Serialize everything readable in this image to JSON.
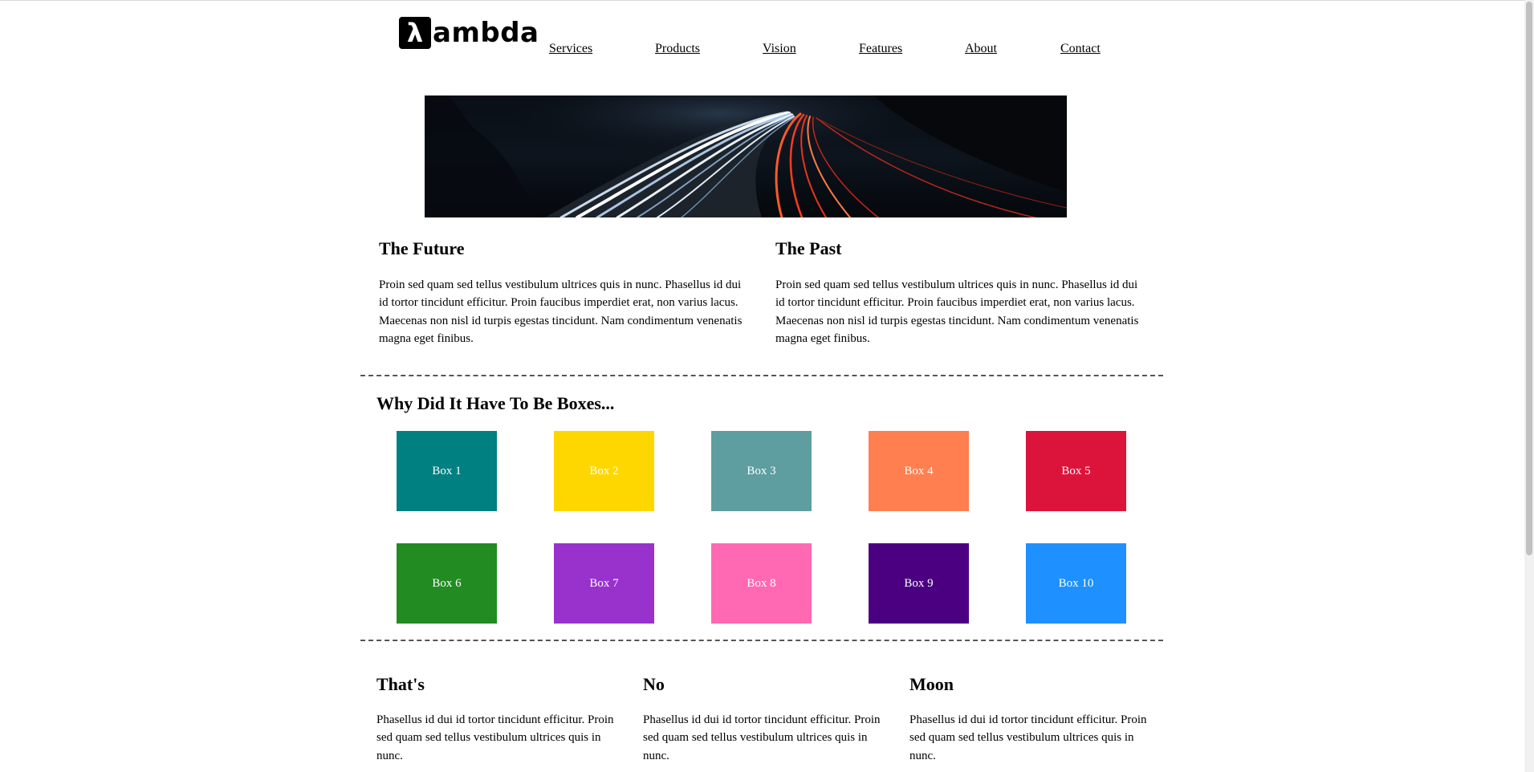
{
  "header": {
    "logo_glyph": "λ",
    "logo_word": "ambda",
    "nav": [
      "Services",
      "Products",
      "Vision",
      "Features",
      "About",
      "Contact"
    ]
  },
  "articles": [
    {
      "title": "The Future",
      "text": "Proin sed quam sed tellus vestibulum ultrices quis in nunc. Phasellus id dui id tortor tincidunt efficitur. Proin faucibus imperdiet erat, non varius lacus. Maecenas non nisl id turpis egestas tincidunt. Nam condimentum venenatis magna eget finibus."
    },
    {
      "title": "The Past",
      "text": "Proin sed quam sed tellus vestibulum ultrices quis in nunc. Phasellus id dui id tortor tincidunt efficitur. Proin faucibus imperdiet erat, non varius lacus. Maecenas non nisl id turpis egestas tincidunt. Nam condimentum venenatis magna eget finibus."
    }
  ],
  "boxes_section": {
    "title": "Why Did It Have To Be Boxes...",
    "boxes": [
      {
        "label": "Box 1",
        "color": "#008080"
      },
      {
        "label": "Box 2",
        "color": "#FFD700"
      },
      {
        "label": "Box 3",
        "color": "#5F9EA0"
      },
      {
        "label": "Box 4",
        "color": "#FF7F50"
      },
      {
        "label": "Box 5",
        "color": "#DC143C"
      },
      {
        "label": "Box 6",
        "color": "#228B22"
      },
      {
        "label": "Box 7",
        "color": "#9932CC"
      },
      {
        "label": "Box 8",
        "color": "#FF69B4"
      },
      {
        "label": "Box 9",
        "color": "#4B0082"
      },
      {
        "label": "Box 10",
        "color": "#1E90FF"
      }
    ]
  },
  "bottom": [
    {
      "title": "That's",
      "text": "Phasellus id dui id tortor tincidunt efficitur. Proin sed quam sed tellus vestibulum ultrices quis in nunc."
    },
    {
      "title": "No",
      "text": "Phasellus id dui id tortor tincidunt efficitur. Proin sed quam sed tellus vestibulum ultrices quis in nunc."
    },
    {
      "title": "Moon",
      "text": "Phasellus id dui id tortor tincidunt efficitur. Proin sed quam sed tellus vestibulum ultrices quis in nunc."
    }
  ]
}
